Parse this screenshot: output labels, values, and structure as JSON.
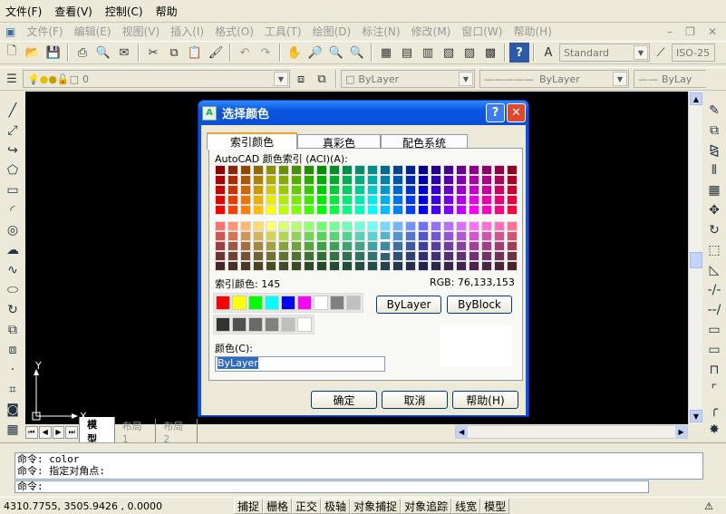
{
  "menubar": {
    "items": [
      {
        "label": "文件(F)"
      },
      {
        "label": "查看(V)"
      },
      {
        "label": "控制(C)"
      },
      {
        "label": "帮助"
      }
    ]
  },
  "appmenu": {
    "items": [
      "文件(F)",
      "编辑(E)",
      "视图(V)",
      "插入(I)",
      "格式(O)",
      "工具(T)",
      "绘图(D)",
      "标注(N)",
      "修改(M)",
      "窗口(W)",
      "帮助(H)"
    ]
  },
  "toolbar": {
    "text_style": "Standard",
    "dim_style": "ISO-25"
  },
  "layers": {
    "current_layer": "0",
    "color": "ByLayer",
    "linetype": "ByLayer",
    "lineweight": "ByLay"
  },
  "canvas": {
    "ucs_y": "Y",
    "ucs_x": "X"
  },
  "layout_tabs": [
    "模型",
    "布局1",
    "布局2"
  ],
  "command": {
    "lines": [
      "命令: color",
      "命令: 指定对角点:"
    ],
    "prompt": "命令:"
  },
  "status": {
    "coords": "4310.7755,  3505.9426 , 0.0000",
    "toggles": [
      "捕捉",
      "栅格",
      "正交",
      "极轴",
      "对象捕捉",
      "对象追踪",
      "线宽",
      "模型"
    ]
  },
  "dialog": {
    "title": "选择颜色",
    "tabs": [
      "索引颜色",
      "真彩色",
      "配色系统"
    ],
    "aci_label": "AutoCAD 颜色索引 (ACI)(A):",
    "index_label": "索引颜色: 145",
    "rgb_label": "RGB:  76,133,153",
    "bylayer_btn": "ByLayer",
    "byblock_btn": "ByBlock",
    "color_label": "颜色(C):",
    "color_value": "ByLayer",
    "ok": "确定",
    "cancel": "取消",
    "help": "帮助(H)",
    "accent": "#0a54e3",
    "std_colors": [
      "#ff0000",
      "#ffff00",
      "#00ff00",
      "#00ffff",
      "#0000ff",
      "#ff00ff",
      "#ffffff",
      "#808080",
      "#c0c0c0"
    ],
    "gray_colors": [
      "#333333",
      "#505050",
      "#696969",
      "#808080",
      "#bebebe",
      "#ffffff"
    ]
  }
}
